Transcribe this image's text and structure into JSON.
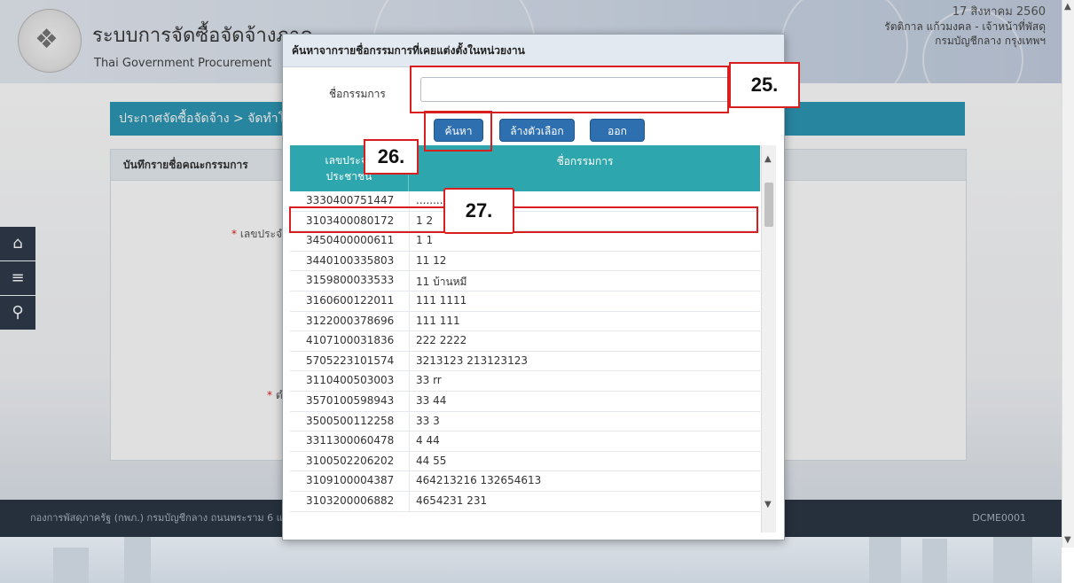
{
  "header": {
    "system_title": "ระบบการจัดซื้อจัดจ้างภาค",
    "system_subtitle": "Thai Government Procurement",
    "date": "17 สิงหาคม 2560",
    "user": "รัตติกาล แก้วมงคล - เจ้าหน้าที่พัสดุ",
    "department": "กรมบัญชีกลาง กรุงเทพฯ"
  },
  "breadcrumb": "ประกาศจัดซื้อจัดจ้าง > จัดทำโ",
  "panel": {
    "title": "บันทึกรายชื่อคณะกรรมการ",
    "label_id": "เลขประจำ",
    "label_pos": "ตำ"
  },
  "sidebar": {
    "home_icon": "home-icon",
    "menu_icon": "menu-icon",
    "search_icon": "search-icon"
  },
  "footer": {
    "address": "กองการพัสดุภาครัฐ (กพภ.) กรมบัญชีกลาง ถนนพระราม 6 แข",
    "code": "DCME0001"
  },
  "modal": {
    "title": "ค้นหาจากรายชื่อกรรมการที่เคยแต่งตั้งในหน่วยงาน",
    "field_label": "ชื่อกรรมการ",
    "field_value": "",
    "search_button": "ค้นหา",
    "clear_button": "ล้างตัวเลือก",
    "exit_button": "ออก",
    "columns": {
      "id_line1": "เลขประจำ",
      "id_line2": "ประชาชน",
      "name": "ชื่อกรรมการ"
    },
    "rows": [
      {
        "id": "3330400751447",
        "name": "........................"
      },
      {
        "id": "3103400080172",
        "name": "1 2"
      },
      {
        "id": "3450400000611",
        "name": "1 1"
      },
      {
        "id": "3440100335803",
        "name": "11 12"
      },
      {
        "id": "3159800033533",
        "name": "11 บ้านหมี"
      },
      {
        "id": "3160600122011",
        "name": "111 1111"
      },
      {
        "id": "3122000378696",
        "name": "111 111"
      },
      {
        "id": "4107100031836",
        "name": "222 2222"
      },
      {
        "id": "5705223101574",
        "name": "3213123 213123123"
      },
      {
        "id": "3110400503003",
        "name": "33 rr"
      },
      {
        "id": "3570100598943",
        "name": "33 44"
      },
      {
        "id": "3500500112258",
        "name": "33 3"
      },
      {
        "id": "3311300060478",
        "name": "4 44"
      },
      {
        "id": "3100502206202",
        "name": "44 55"
      },
      {
        "id": "3109100004387",
        "name": "464213216 132654613"
      },
      {
        "id": "3103200006882",
        "name": "4654231 231"
      }
    ]
  },
  "annotations": {
    "step_25": "25.",
    "step_26": "26.",
    "step_27": "27."
  },
  "colors": {
    "accent": "#2e98b5",
    "table_header": "#2ea6ad",
    "button": "#2e6fb0",
    "annotation": "#d81e1e"
  }
}
